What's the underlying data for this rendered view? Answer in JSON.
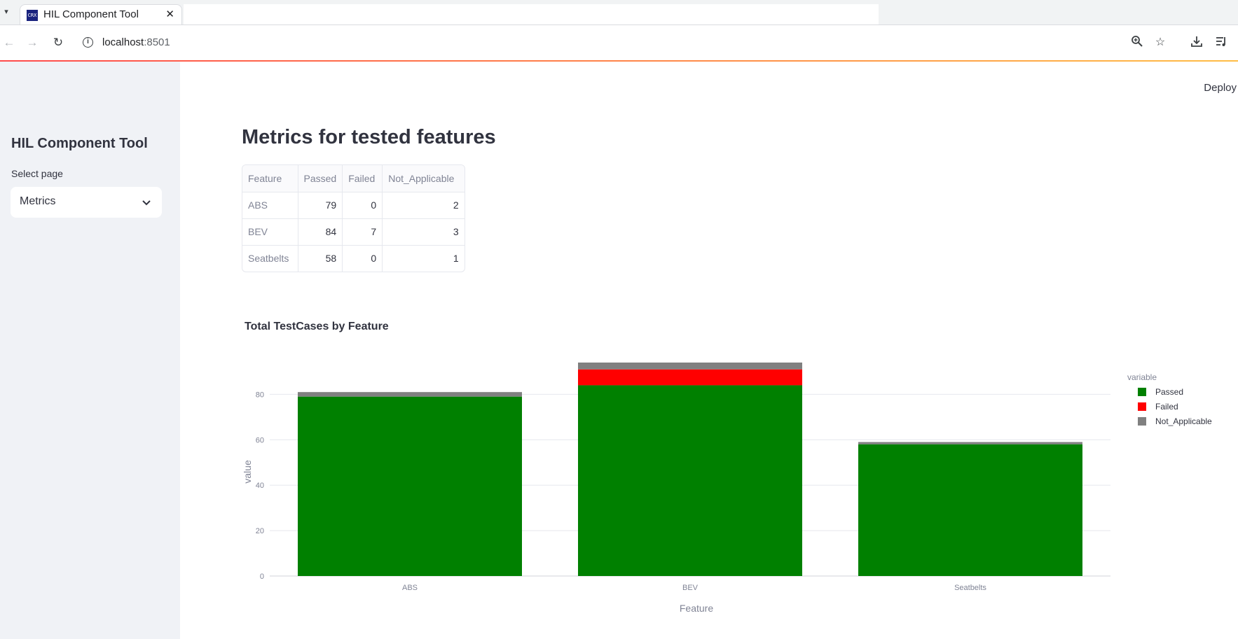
{
  "browser": {
    "tab_menu_icon": "chevron-down-icon",
    "tab_favicon_text": "CRX",
    "tab_title": "HIL Component Tool",
    "url_host": "localhost",
    "url_port": ":8501"
  },
  "sidebar": {
    "title": "HIL Component Tool",
    "select_label": "Select page",
    "select_value": "Metrics"
  },
  "header": {
    "deploy_label": "Deploy"
  },
  "main": {
    "title": "Metrics for tested features",
    "table": {
      "columns": [
        "Feature",
        "Passed",
        "Failed",
        "Not_Applicable"
      ],
      "rows": [
        [
          "ABS",
          "79",
          "0",
          "2"
        ],
        [
          "BEV",
          "84",
          "7",
          "3"
        ],
        [
          "Seatbelts",
          "58",
          "0",
          "1"
        ]
      ]
    }
  },
  "chart_data": {
    "type": "bar",
    "stacked": true,
    "title": "Total TestCases by Feature",
    "xlabel": "Feature",
    "ylabel": "value",
    "categories": [
      "ABS",
      "BEV",
      "Seatbelts"
    ],
    "series": [
      {
        "name": "Passed",
        "values": [
          79,
          84,
          58
        ],
        "color": "#008000"
      },
      {
        "name": "Failed",
        "values": [
          0,
          7,
          0
        ],
        "color": "#ff0000"
      },
      {
        "name": "Not_Applicable",
        "values": [
          2,
          3,
          1
        ],
        "color": "#808080"
      }
    ],
    "ylim": [
      0,
      94
    ],
    "yticks": [
      0,
      20,
      40,
      60,
      80
    ],
    "grid": true,
    "legend_title": "variable",
    "legend_position": "right"
  }
}
